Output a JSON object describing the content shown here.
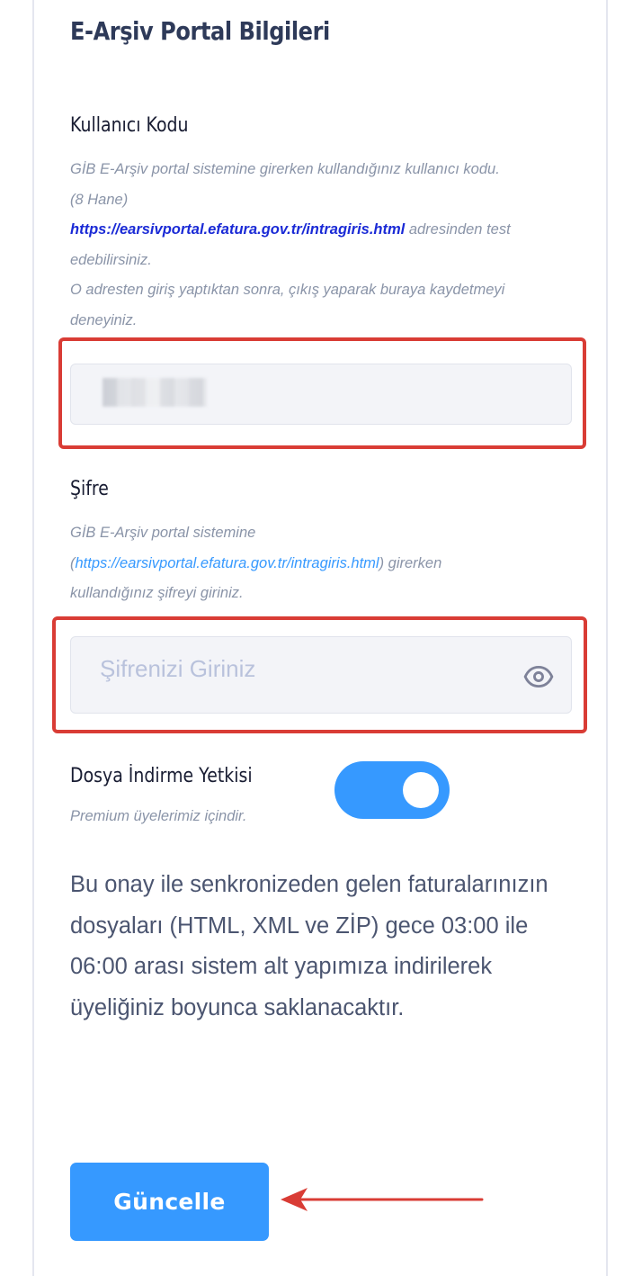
{
  "section": {
    "title": "E-Arşiv Portal Bilgileri"
  },
  "user_code": {
    "label": "Kullanıcı Kodu",
    "help_line1": "GİB E-Arşiv portal sistemine girerken kullandığınız kullanıcı kodu.",
    "help_line2": "(8 Hane)",
    "help_link": "https://earsivportal.efatura.gov.tr/intragiris.html",
    "help_line3_suffix": " adresinden test",
    "help_line4": "edebilirsiniz.",
    "help_line5": "O adresten giriş yaptıktan sonra, çıkış yaparak buraya kaydetmeyi",
    "help_line6": "deneyiniz."
  },
  "password": {
    "label": "Şifre",
    "help_line1": "GİB E-Arşiv portal sistemine",
    "help_paren_open": "(",
    "help_link": "https://earsivportal.efatura.gov.tr/intragiris.html",
    "help_line2_suffix": ") girerken",
    "help_line3": "kullandığınız şifreyi giriniz.",
    "placeholder": "Şifrenizi Giriniz",
    "toggle_icon": "eye-icon"
  },
  "file_download": {
    "label": "Dosya İndirme Yetkisi",
    "note": "Premium üyelerimiz içindir.",
    "enabled": true,
    "description": "Bu onay ile senkronizeden gelen faturalarınızın dosyaları (HTML, XML ve ZİP) gece 03:00 ile 06:00 arası sistem alt yapımıza indirilerek üyeliğiniz boyunca saklanacaktır."
  },
  "actions": {
    "update_label": "Güncelle"
  },
  "colors": {
    "primary": "#3699ff",
    "highlight": "#d93c35",
    "heading": "#2e3a59",
    "muted": "#8a94a8",
    "input_bg": "#f3f4f8"
  }
}
